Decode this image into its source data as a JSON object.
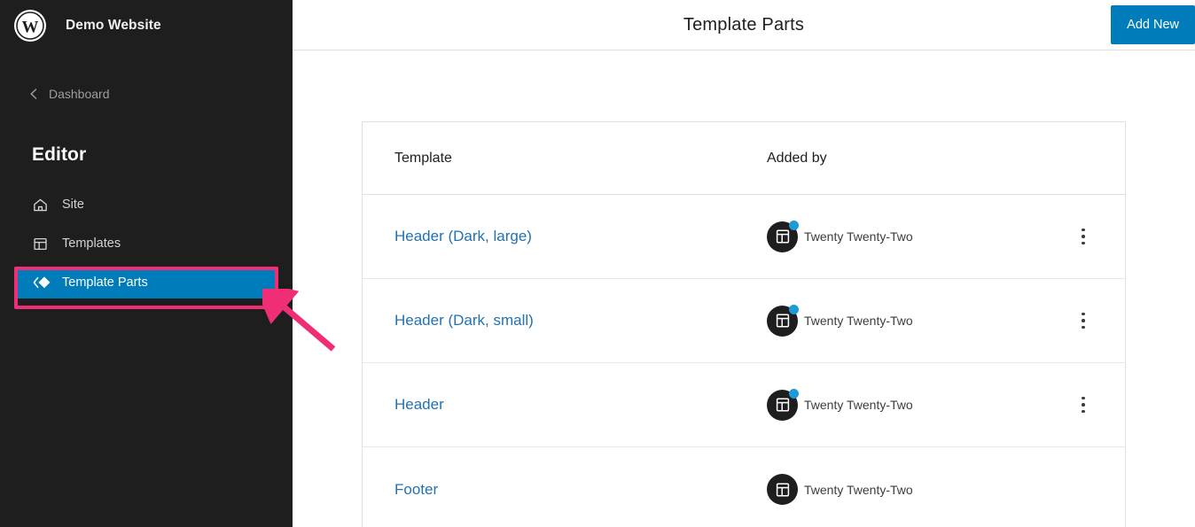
{
  "sidebar": {
    "logo_icon": "wordpress-logo-icon",
    "site_title": "Demo Website",
    "back_link": {
      "label": "Dashboard",
      "icon": "chevron-left-icon"
    },
    "section_title": "Editor",
    "items": [
      {
        "label": "Site",
        "icon": "home-icon",
        "active": false
      },
      {
        "label": "Templates",
        "icon": "layout-icon",
        "active": false
      },
      {
        "label": "Template Parts",
        "icon": "template-parts-icon",
        "active": true
      }
    ]
  },
  "header": {
    "title": "Template Parts",
    "add_new_label": "Add New"
  },
  "table": {
    "columns": [
      "Template",
      "Added by"
    ],
    "rows": [
      {
        "template": "Header (Dark, large)",
        "added_by": "Twenty Twenty-Two",
        "avatar_icon": "theme-avatar-icon",
        "badge": true,
        "menu_icon": "kebab-menu-icon",
        "menu_visible": true
      },
      {
        "template": "Header (Dark, small)",
        "added_by": "Twenty Twenty-Two",
        "avatar_icon": "theme-avatar-icon",
        "badge": true,
        "menu_icon": "kebab-menu-icon",
        "menu_visible": true
      },
      {
        "template": "Header",
        "added_by": "Twenty Twenty-Two",
        "avatar_icon": "theme-avatar-icon",
        "badge": true,
        "menu_icon": "kebab-menu-icon",
        "menu_visible": true
      },
      {
        "template": "Footer",
        "added_by": "Twenty Twenty-Two",
        "avatar_icon": "theme-avatar-icon",
        "badge": false,
        "menu_icon": "kebab-menu-icon",
        "menu_visible": false
      }
    ]
  },
  "annotations": {
    "highlight_color": "#ef2e76",
    "highlight_target": "Template Parts",
    "arrow_color": "#ef2e76"
  },
  "colors": {
    "sidebar_bg": "#1e1e1e",
    "accent_blue": "#007cba",
    "link_blue": "#2271b1",
    "badge_blue": "#1d9bd7"
  }
}
